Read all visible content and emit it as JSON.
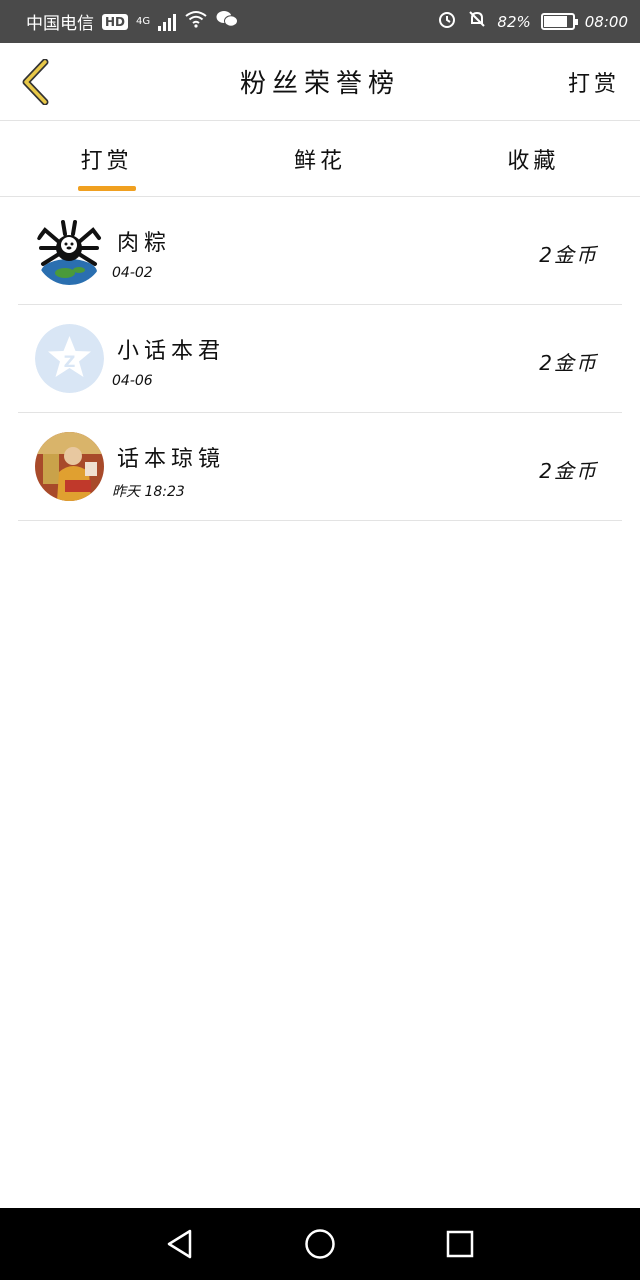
{
  "status_bar": {
    "carrier": "中国电信",
    "hd": "HD",
    "network": "4G",
    "battery": "82%",
    "battery_level": 0.82,
    "time": "08:00"
  },
  "header": {
    "title": "粉丝荣誉榜",
    "action_label": "打赏",
    "accent_color": "#e8c848"
  },
  "tabs": [
    {
      "label": "打赏",
      "active": true
    },
    {
      "label": "鲜花",
      "active": false
    },
    {
      "label": "收藏",
      "active": false
    }
  ],
  "tab_underline_color": "#f0a020",
  "items": [
    {
      "name": "肉粽",
      "time": "04-02",
      "amount": "2金币",
      "avatar": "spider-bear-earth-icon"
    },
    {
      "name": "小话本君",
      "time": "04-06",
      "amount": "2金币",
      "avatar": "default-star-avatar-icon"
    },
    {
      "name": "话本琼镜",
      "time": "昨天 18:23",
      "amount": "2金币",
      "avatar": "monk-photo-avatar-icon"
    }
  ]
}
